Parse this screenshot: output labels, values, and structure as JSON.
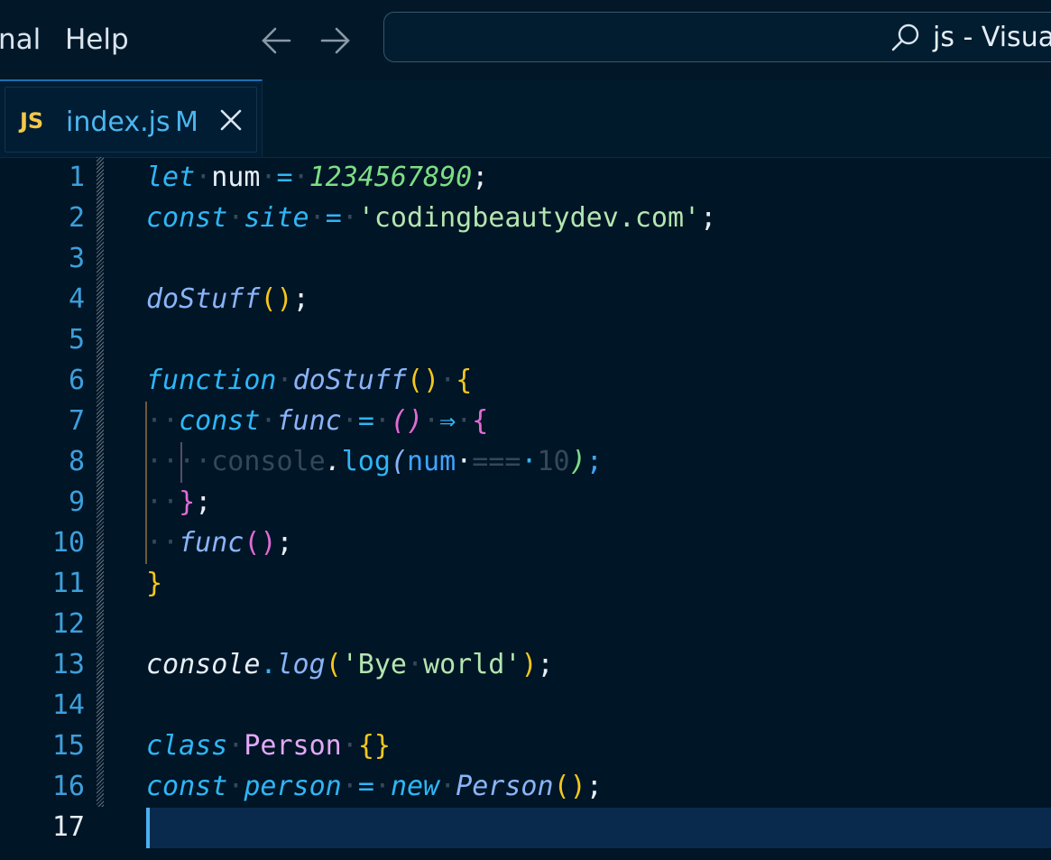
{
  "menu": {
    "terminal_label": "nal",
    "help_label": "Help"
  },
  "search": {
    "text": "js - Visual"
  },
  "tab": {
    "lang_badge": "JS",
    "filename": "index.js",
    "status": "M"
  },
  "editor": {
    "line_numbers": [
      "1",
      "2",
      "3",
      "4",
      "5",
      "6",
      "7",
      "8",
      "9",
      "10",
      "11",
      "12",
      "13",
      "14",
      "15",
      "16",
      "17"
    ],
    "current_line": "17"
  },
  "colors": {
    "background": "#001526",
    "keyword": "#2fb6f6",
    "function": "#8ab4f8",
    "number": "#7dde85",
    "string": "#b3e6b0",
    "bracket_level1": "#f4c81b",
    "bracket_level2": "#e06cd5",
    "bracket_level3": "#3fa5ff",
    "class": "#e3a8f7",
    "js_badge": "#f2c84b",
    "tab_text": "#4cb6f0"
  },
  "code": {
    "l1": [
      "let",
      "·",
      "num",
      "·",
      "=",
      "·",
      "1234567890",
      ";"
    ],
    "l2": [
      "const",
      "·",
      "site",
      "·",
      "=",
      "·",
      "'codingbeautydev.com'",
      ";"
    ],
    "l4": [
      "doStuff",
      "(",
      ")",
      ";"
    ],
    "l6": [
      "function",
      "·",
      "doStuff",
      "(",
      ")",
      "·",
      "{"
    ],
    "l7": [
      "··",
      "const",
      "·",
      "func",
      "·",
      "=",
      "·",
      "(",
      ")",
      "·",
      "⇒",
      "·",
      "{"
    ],
    "l8": [
      "··",
      "·",
      "·",
      "console",
      ".",
      "log",
      "(",
      "num",
      "·",
      "===",
      "·",
      "10",
      ")",
      ";"
    ],
    "l9": [
      "··",
      "}",
      ";"
    ],
    "l10": [
      "··",
      "func",
      "(",
      ")",
      ";"
    ],
    "l11": [
      "}"
    ],
    "l13": [
      "console",
      ".",
      "log",
      "(",
      "'Bye",
      "·",
      "world'",
      ")",
      ";"
    ],
    "l15": [
      "class",
      "·",
      "Person",
      "·",
      "{",
      "}"
    ],
    "l16": [
      "const",
      "·",
      "person",
      "·",
      "=",
      "·",
      "new",
      "·",
      "Person",
      "(",
      ")",
      ";"
    ]
  }
}
